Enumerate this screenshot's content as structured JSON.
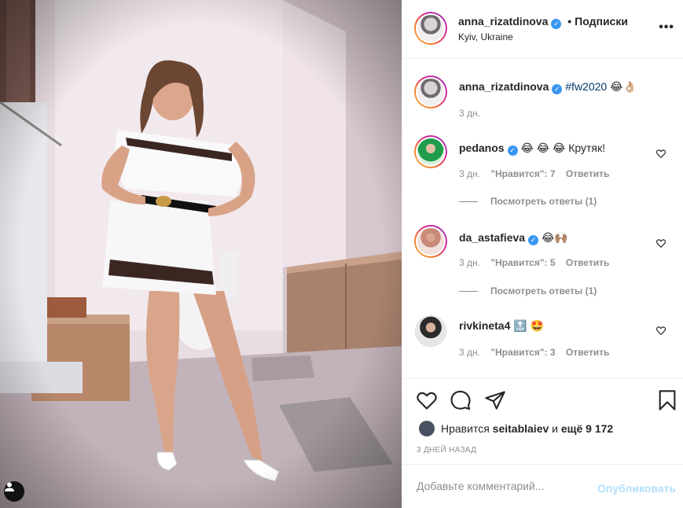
{
  "header": {
    "username": "anna_rizatdinova",
    "separator": "•",
    "follow_label": "Подписки",
    "location": "Kyiv, Ukraine",
    "more_icon": "more-horizontal-icon"
  },
  "caption": {
    "username": "anna_rizatdinova",
    "hashtag": "#fw2020",
    "emojis": "😂👌🏼",
    "time": "3 дн."
  },
  "comments": [
    {
      "username": "pedanos",
      "verified": true,
      "text": "😂 😂 😂 Крутяк!",
      "time": "3 дн.",
      "likes": "\"Нравится\": 7",
      "reply_label": "Ответить",
      "view_replies": "Посмотреть ответы (1)"
    },
    {
      "username": "da_astafieva",
      "verified": true,
      "text": "😂🙌🏽",
      "time": "3 дн.",
      "likes": "\"Нравится\": 5",
      "reply_label": "Ответить",
      "view_replies": "Посмотреть ответы (1)"
    },
    {
      "username": "rivkineta4",
      "verified": false,
      "text": "🔝 🤩",
      "time": "3 дн.",
      "likes": "\"Нравится\": 3",
      "reply_label": "Ответить"
    }
  ],
  "actions": {
    "likes_prefix": "Нравится",
    "likes_user": "seitablaiev",
    "likes_conjunction": "и",
    "likes_more": "ещё 9 172",
    "date": "3 ДНЕЙ НАЗАД"
  },
  "comment_box": {
    "placeholder": "Добавьте комментарий...",
    "publish_label": "Опубликовать"
  },
  "colors": {
    "link_blue": "#3897f0",
    "publish_disabled": "#b2dffc",
    "meta_gray": "#8e8e8e",
    "hashtag": "#00376b"
  }
}
